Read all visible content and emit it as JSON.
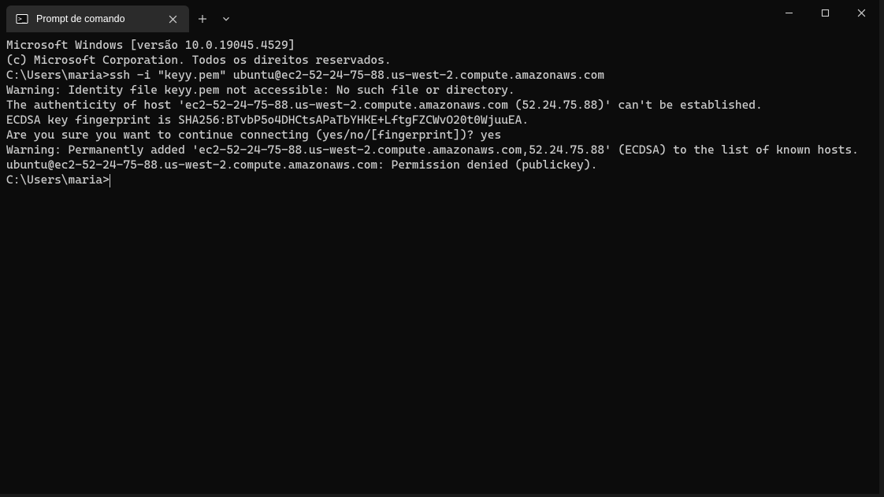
{
  "titlebar": {
    "tab_title": "Prompt de comando",
    "icons": {
      "tab": "cmd-icon",
      "close_tab": "close-icon",
      "new_tab": "plus-icon",
      "dropdown": "chevron-down-icon",
      "minimize": "minimize-icon",
      "maximize": "maximize-icon",
      "close_window": "close-icon"
    }
  },
  "terminal": {
    "lines": [
      "Microsoft Windows [versão 10.0.19045.4529]",
      "(c) Microsoft Corporation. Todos os direitos reservados.",
      "",
      "C:\\Users\\maria>ssh -i \"keyy.pem\" ubuntu@ec2-52-24-75-88.us-west-2.compute.amazonaws.com",
      "Warning: Identity file keyy.pem not accessible: No such file or directory.",
      "The authenticity of host 'ec2-52-24-75-88.us-west-2.compute.amazonaws.com (52.24.75.88)' can't be established.",
      "ECDSA key fingerprint is SHA256:BTvbP5o4DHCtsAPaTbYHKE+LftgFZCWvO20t0WjuuEA.",
      "Are you sure you want to continue connecting (yes/no/[fingerprint])? yes",
      "Warning: Permanently added 'ec2-52-24-75-88.us-west-2.compute.amazonaws.com,52.24.75.88' (ECDSA) to the list of known hosts.",
      "ubuntu@ec2-52-24-75-88.us-west-2.compute.amazonaws.com: Permission denied (publickey).",
      "",
      "C:\\Users\\maria>"
    ],
    "prompt_has_cursor": true
  }
}
